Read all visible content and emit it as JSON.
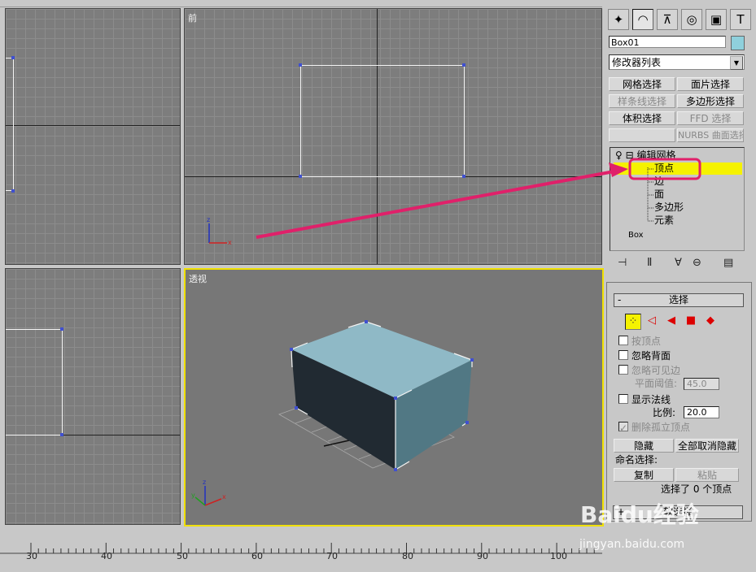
{
  "viewports": {
    "top_left": {
      "label": ""
    },
    "front": {
      "label": "前"
    },
    "left": {
      "label": ""
    },
    "perspective": {
      "label": "透视"
    }
  },
  "panel": {
    "tabs": [
      {
        "icon": "create-tab-icon"
      },
      {
        "icon": "modify-tab-icon"
      },
      {
        "icon": "hierarchy-tab-icon"
      },
      {
        "icon": "motion-tab-icon"
      },
      {
        "icon": "display-tab-icon"
      },
      {
        "icon": "utilities-tab-icon"
      }
    ],
    "object_name": "Box01",
    "object_color": "#8fd0dc",
    "modifier_list": "修改器列表",
    "buttons": {
      "mesh_select": "网格选择",
      "patch_select": "面片选择",
      "spline_select": "样条线选择",
      "poly_select": "多边形选择",
      "volume_select": "体积选择",
      "ffd_select": "FFD 选择",
      "nurbs_select": "NURBS 曲面选择"
    },
    "stack": {
      "edit_mesh": "编辑网格",
      "items": [
        "顶点",
        "边",
        "面",
        "多边形",
        "元素"
      ],
      "base": "Box"
    },
    "selection_rollout": {
      "title": "选择",
      "collapse_sign": "-",
      "by_vertex": "按顶点",
      "ignore_backface": "忽略背面",
      "ignore_visible_edges": "忽略可见边",
      "planar_threshold_label": "平面阈值:",
      "planar_threshold_value": "45.0",
      "show_normals": "显示法线",
      "scale_label": "比例:",
      "scale_value": "20.0",
      "delete_isolated": "删除孤立顶点",
      "hide": "隐藏",
      "unhide_all": "全部取消隐藏",
      "named_selection": "命名选择:",
      "copy": "复制",
      "paste": "粘贴",
      "status": "选择了 0 个顶点"
    },
    "soft_selection": {
      "title": "软选择",
      "expand_sign": "+"
    }
  },
  "ruler": {
    "labels": [
      "30",
      "40",
      "50",
      "60",
      "70",
      "80",
      "90",
      "100"
    ]
  },
  "watermark": {
    "brand": "Baidu经验",
    "url": "jingyan.baidu.com"
  },
  "colors": {
    "highlight": "#f5f200",
    "arrow": "#e0206a",
    "vertex": "#4050d0",
    "box_top": "#8fb9c6"
  }
}
